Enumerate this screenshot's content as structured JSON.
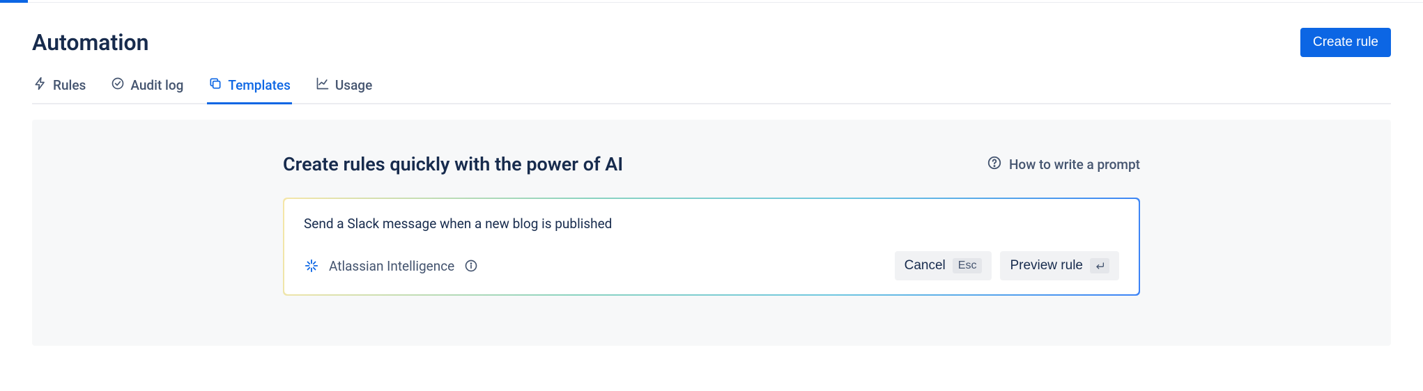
{
  "header": {
    "title": "Automation",
    "create_button": "Create rule"
  },
  "tabs": [
    {
      "label": "Rules",
      "icon": "bolt-icon",
      "active": false
    },
    {
      "label": "Audit log",
      "icon": "check-circle-icon",
      "active": false
    },
    {
      "label": "Templates",
      "icon": "copy-icon",
      "active": true
    },
    {
      "label": "Usage",
      "icon": "chart-icon",
      "active": false
    }
  ],
  "panel": {
    "heading": "Create rules quickly with the power of AI",
    "help_label": "How to write a prompt",
    "prompt_value": "Send a Slack message when a new blog is published",
    "ai_brand": "Atlassian Intelligence",
    "cancel_label": "Cancel",
    "cancel_key": "Esc",
    "preview_label": "Preview rule"
  }
}
